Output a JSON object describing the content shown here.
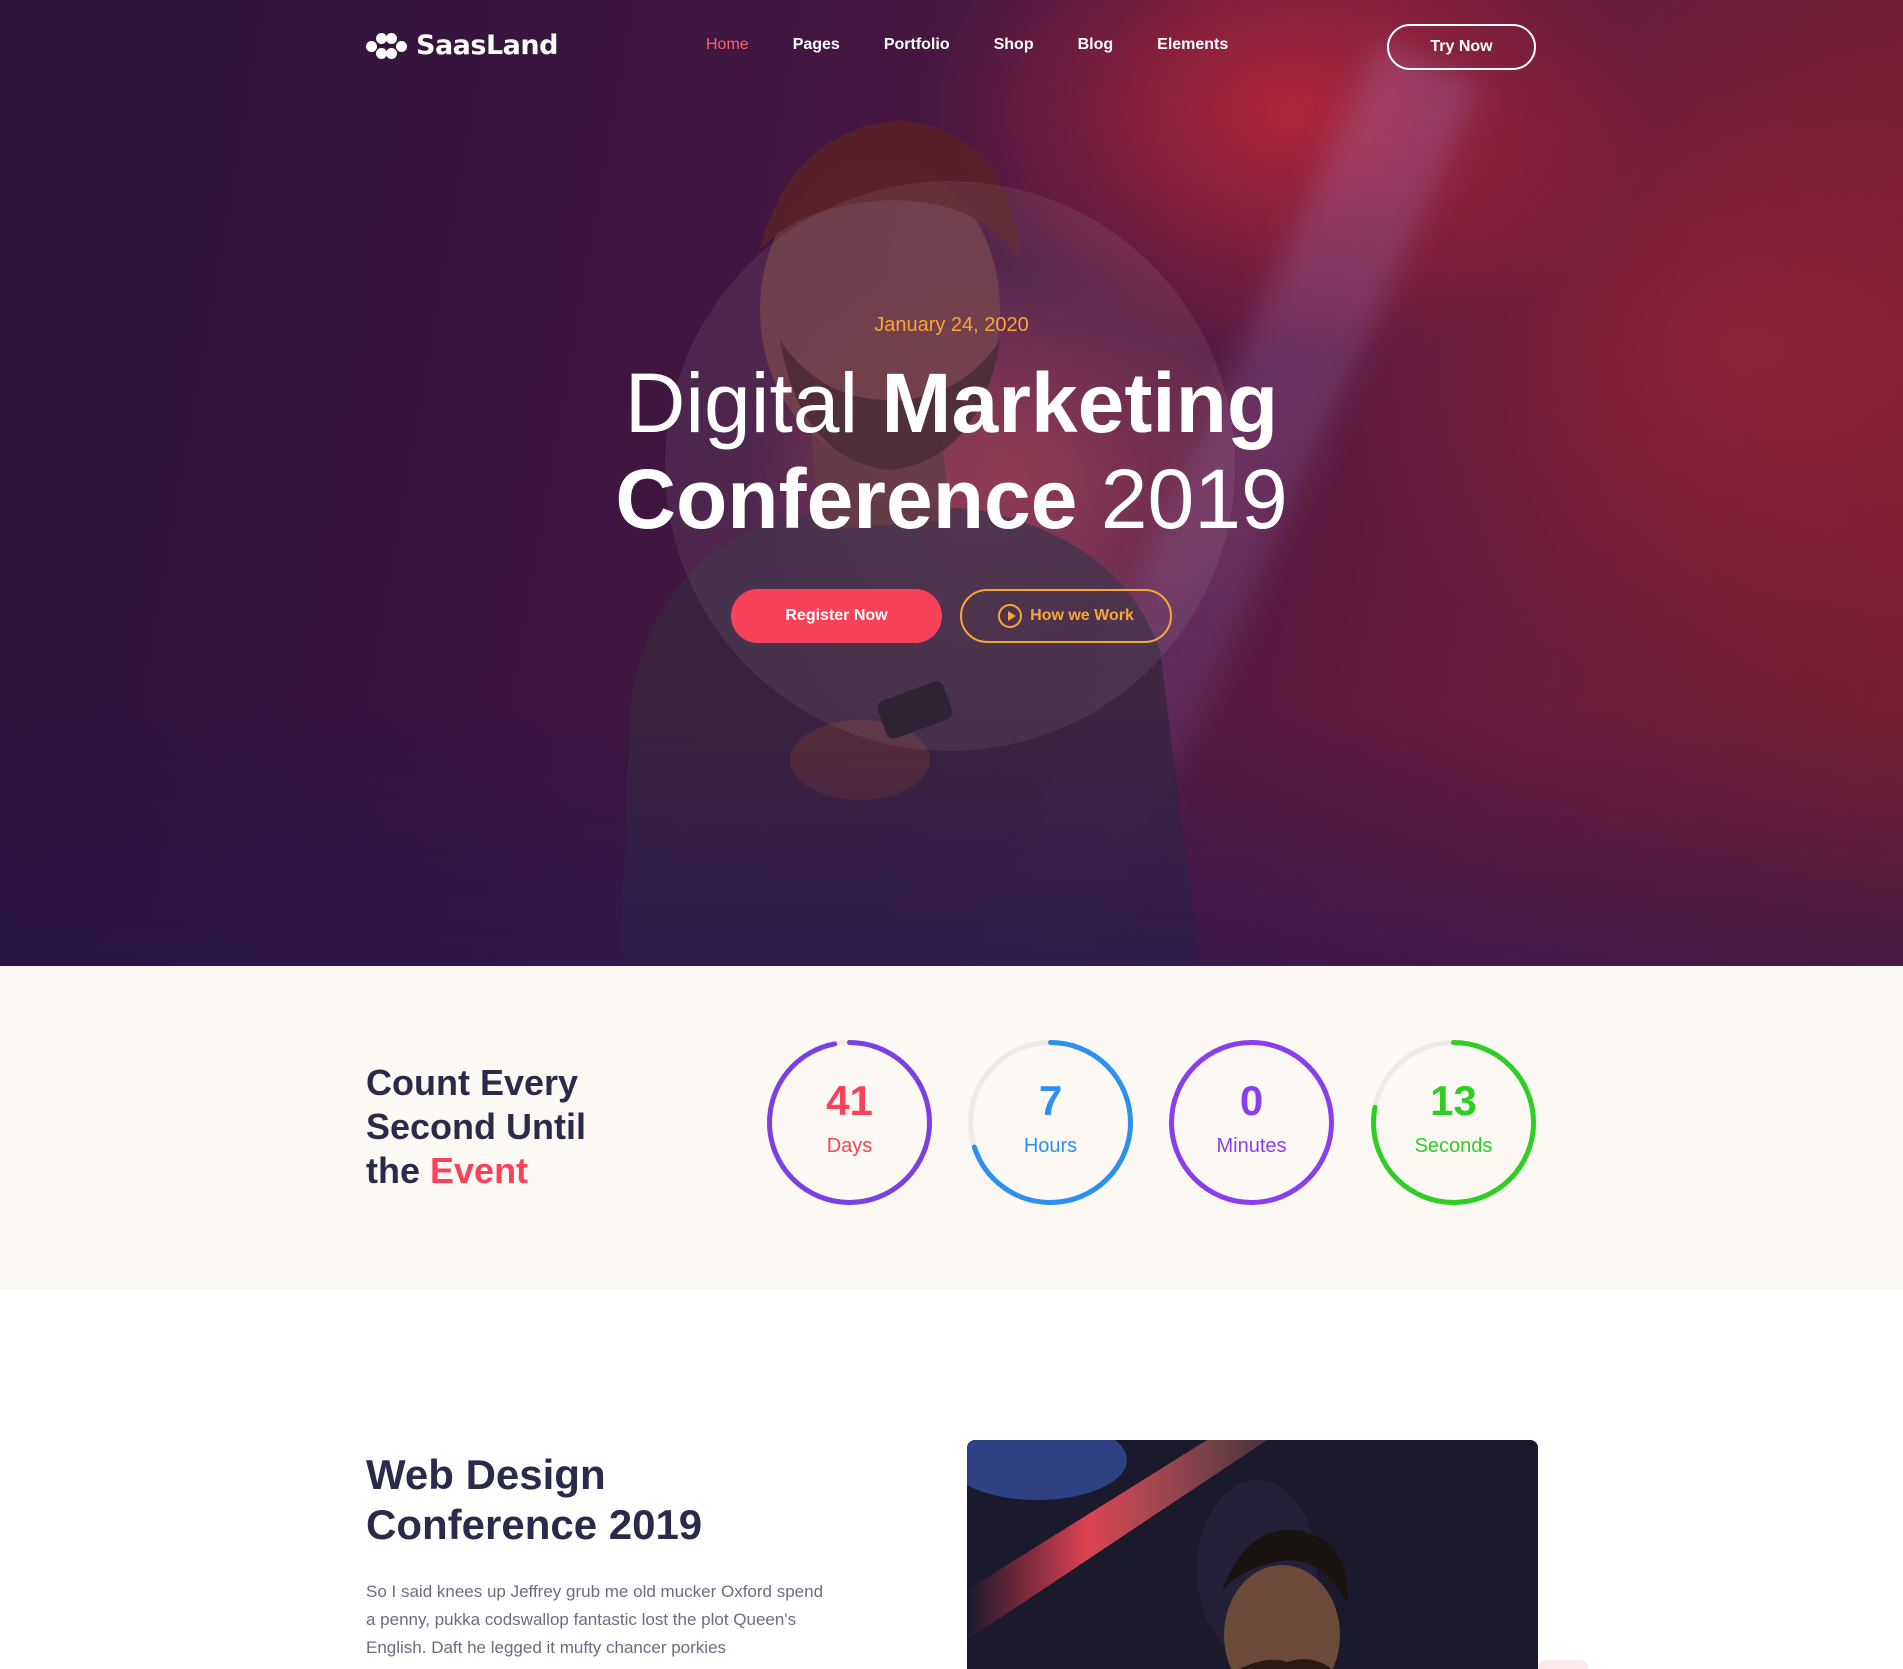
{
  "header": {
    "logo_text": "SaasLand",
    "menu": [
      {
        "label": "Home",
        "active": true
      },
      {
        "label": "Pages",
        "active": false
      },
      {
        "label": "Portfolio",
        "active": false
      },
      {
        "label": "Shop",
        "active": false
      },
      {
        "label": "Blog",
        "active": false
      },
      {
        "label": "Elements",
        "active": false
      }
    ],
    "cta_label": "Try Now"
  },
  "hero": {
    "date": "January 24, 2020",
    "title_line1_light": "Digital ",
    "title_line1_bold": "Marketing",
    "title_line2_bold": "Conference",
    "title_line2_light": " 2019",
    "register_label": "Register Now",
    "how_label": "How we Work"
  },
  "countdown": {
    "heading_line1": "Count Every",
    "heading_line2": "Second Until",
    "heading_line3_plain": "the ",
    "heading_line3_accent": "Event",
    "timers": [
      {
        "value": "41",
        "label": "Days",
        "progress": 0.97,
        "ring_color": "#7b3fe4",
        "num_color": "#f84259",
        "label_color": "#f84259"
      },
      {
        "value": "7",
        "label": "Hours",
        "progress": 0.7,
        "ring_color": "#2d8fef",
        "num_color": "#2d8fef",
        "label_color": "#2d8fef"
      },
      {
        "value": "0",
        "label": "Minutes",
        "progress": 1.0,
        "ring_color": "#8a3ef0",
        "num_color": "#8a3ef0",
        "label_color": "#8a3ef0"
      },
      {
        "value": "13",
        "label": "Seconds",
        "progress": 0.78,
        "ring_color": "#2fce24",
        "num_color": "#2fce24",
        "label_color": "#2fce24"
      }
    ]
  },
  "about": {
    "title_line1": "Web Design",
    "title_line2": "Conference 2019",
    "text": "So I said knees up Jeffrey grub me old mucker Oxford spend a penny, pukka codswallop fantastic lost the plot Queen's English. Daft he legged it mufty chancer porkies"
  },
  "colors": {
    "accent": "#f84259",
    "orange": "#f7a733",
    "heading": "#2a2a4a"
  }
}
